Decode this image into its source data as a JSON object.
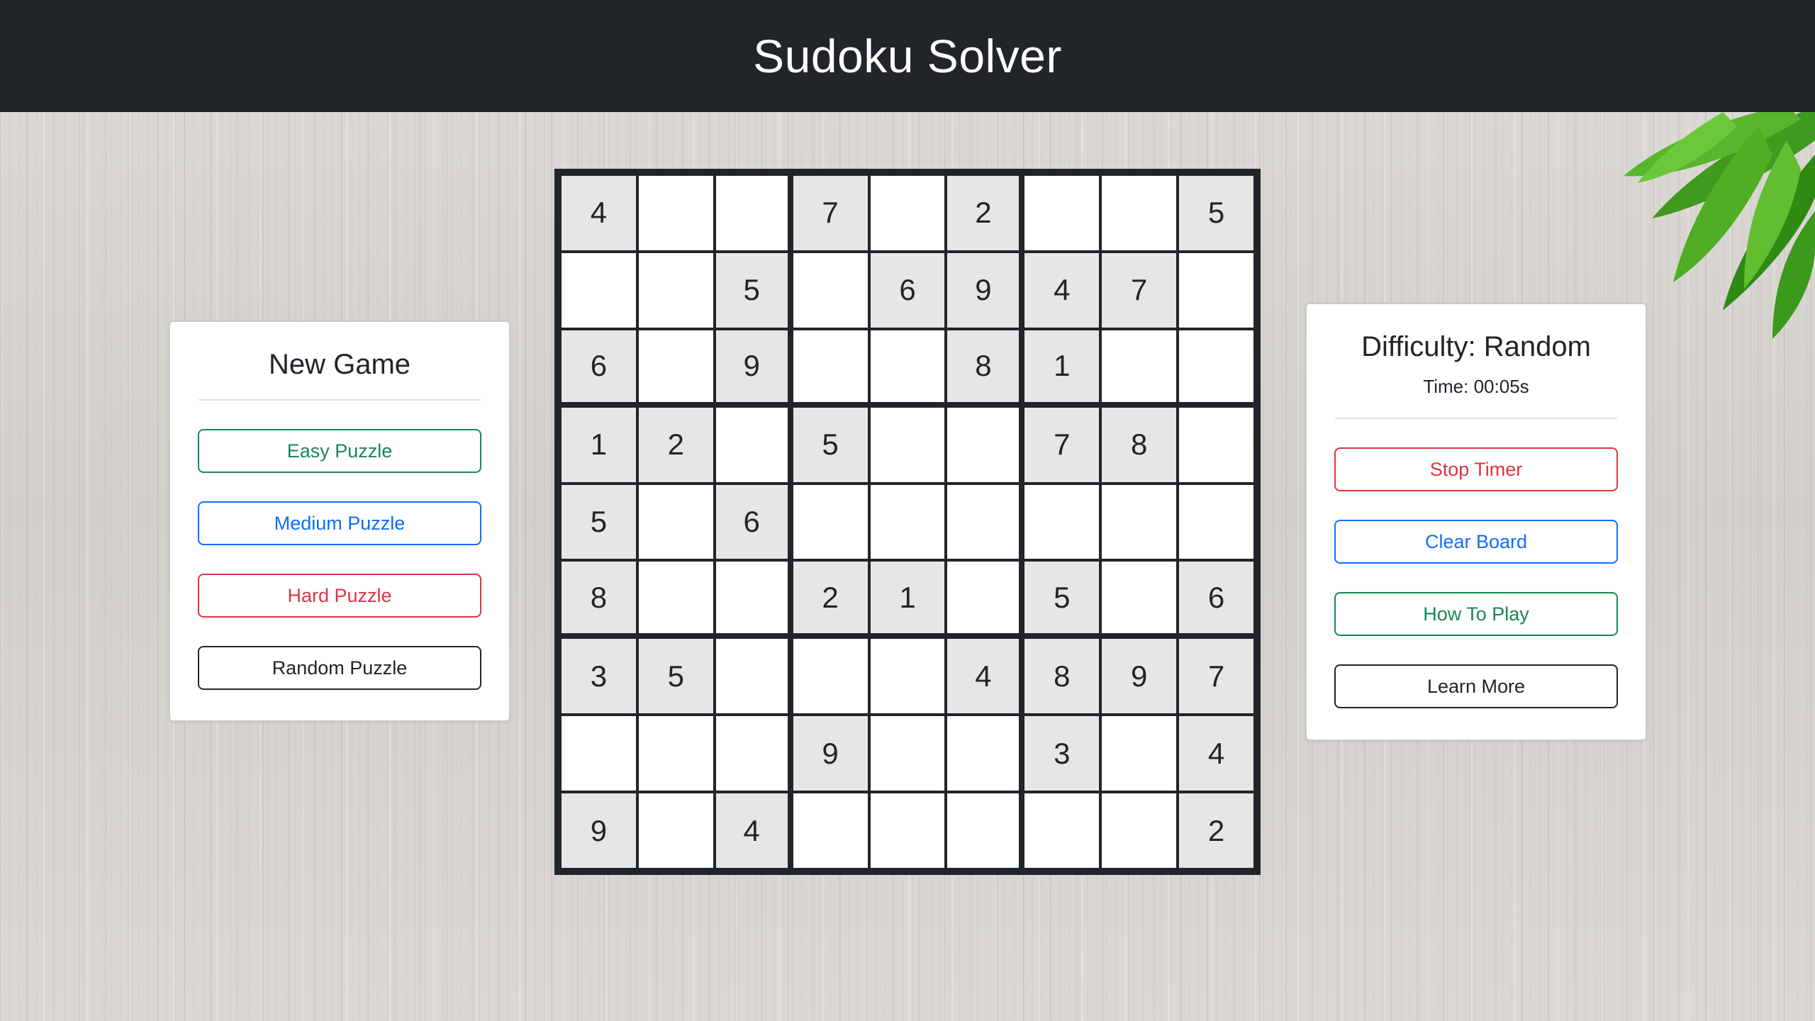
{
  "header": {
    "title": "Sudoku Solver"
  },
  "new_game": {
    "title": "New Game",
    "buttons": {
      "easy": "Easy Puzzle",
      "medium": "Medium Puzzle",
      "hard": "Hard Puzzle",
      "random": "Random Puzzle"
    }
  },
  "status": {
    "difficulty": "Difficulty: Random",
    "time": "Time: 00:05s",
    "buttons": {
      "stop_timer": "Stop Timer",
      "clear_board": "Clear Board",
      "how_to_play": "How To Play",
      "learn_more": "Learn More"
    }
  },
  "board": {
    "rows": [
      [
        "4",
        "",
        "",
        "7",
        "",
        "2",
        "",
        "",
        "5"
      ],
      [
        "",
        "",
        "5",
        "",
        "6",
        "9",
        "4",
        "7",
        ""
      ],
      [
        "6",
        "",
        "9",
        "",
        "",
        "8",
        "1",
        "",
        ""
      ],
      [
        "1",
        "2",
        "",
        "5",
        "",
        "",
        "7",
        "8",
        ""
      ],
      [
        "5",
        "",
        "6",
        "",
        "",
        "",
        "",
        "",
        ""
      ],
      [
        "8",
        "",
        "",
        "2",
        "1",
        "",
        "5",
        "",
        "6"
      ],
      [
        "3",
        "5",
        "",
        "",
        "",
        "4",
        "8",
        "9",
        "7"
      ],
      [
        "",
        "",
        "",
        "9",
        "",
        "",
        "3",
        "",
        "4"
      ],
      [
        "9",
        "",
        "4",
        "",
        "",
        "",
        "",
        "",
        "2"
      ]
    ]
  },
  "colors": {
    "header_bg": "#212529",
    "given_cell_bg": "#e6e6e6",
    "green": "#198754",
    "blue": "#0d6efd",
    "red": "#dc3545",
    "dark": "#212529"
  }
}
